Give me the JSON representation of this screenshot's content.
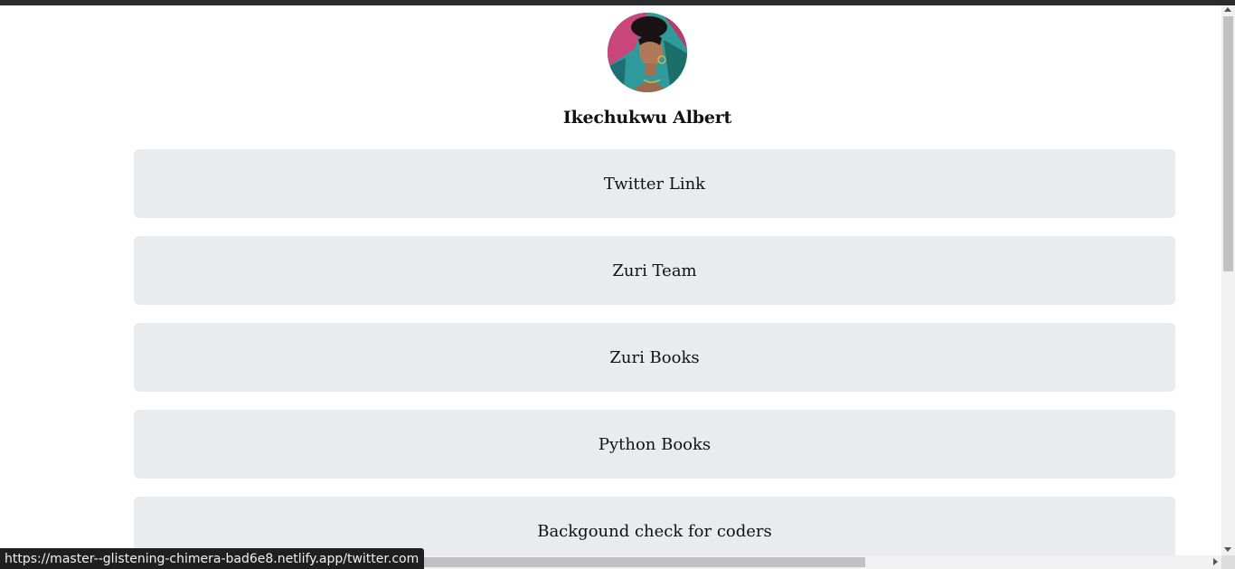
{
  "profile": {
    "name": "Ikechukwu Albert",
    "avatar_icon": "profile-photo"
  },
  "links": [
    {
      "label": "Twitter Link"
    },
    {
      "label": "Zuri Team"
    },
    {
      "label": "Zuri Books"
    },
    {
      "label": "Python Books"
    },
    {
      "label": "Backgound check for coders"
    }
  ],
  "status_bar": {
    "url": "https://master--glistening-chimera-bad6e8.netlify.app/twitter.com"
  },
  "colors": {
    "card_background": "#eaebef",
    "text": "#111111",
    "status_bar_background": "#1f1f1f"
  }
}
